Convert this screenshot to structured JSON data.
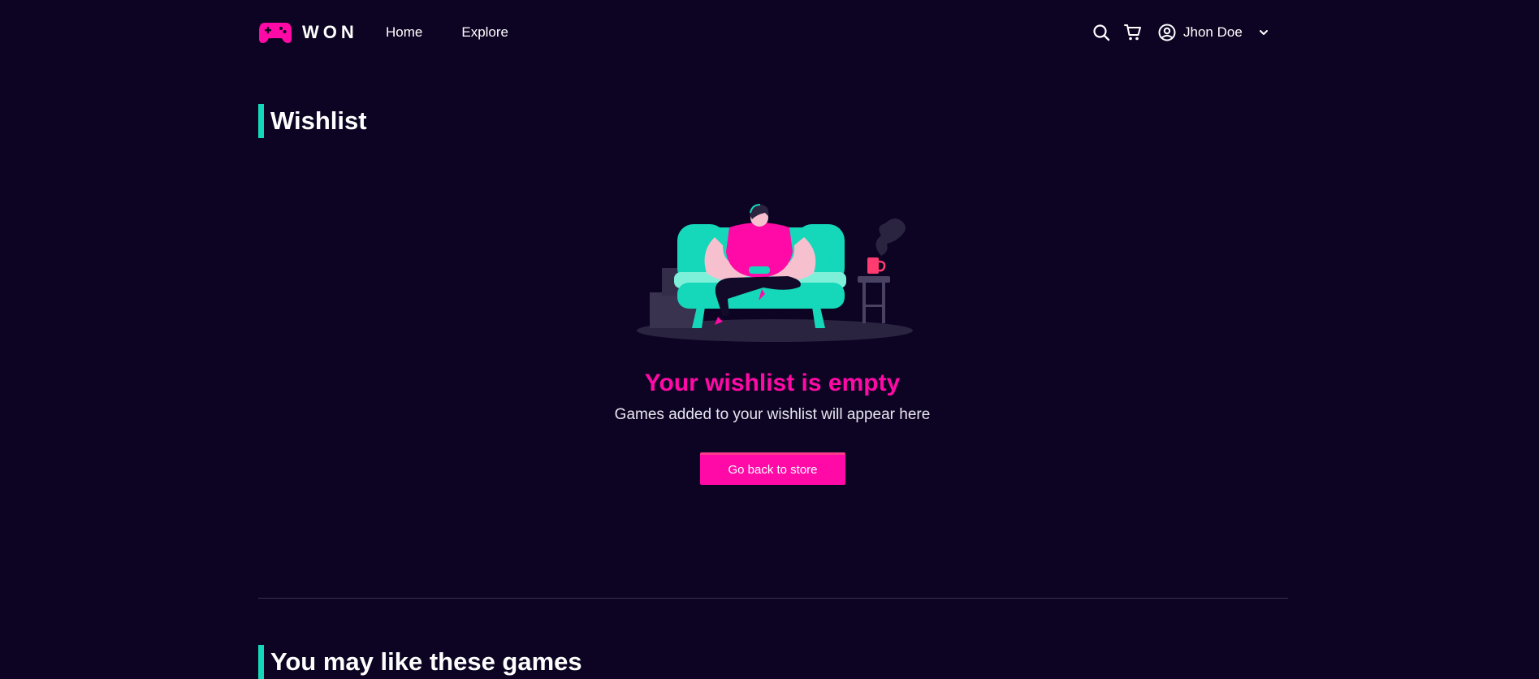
{
  "header": {
    "logo_text": "WON",
    "nav": [
      "Home",
      "Explore"
    ],
    "user_name": "Jhon Doe",
    "icons": {
      "search": "search-icon",
      "cart": "cart-icon",
      "user": "user-circle-icon",
      "chevron": "chevron-down-icon"
    }
  },
  "wishlist": {
    "title": "Wishlist",
    "empty_title": "Your wishlist is empty",
    "empty_subtitle": "Games added to your wishlist will appear here",
    "button_label": "Go back to store"
  },
  "recommendations": {
    "title": "You may like these games"
  },
  "colors": {
    "background": "#0d0423",
    "accent_pink": "#ff0aa6",
    "accent_teal": "#14d8b9"
  }
}
